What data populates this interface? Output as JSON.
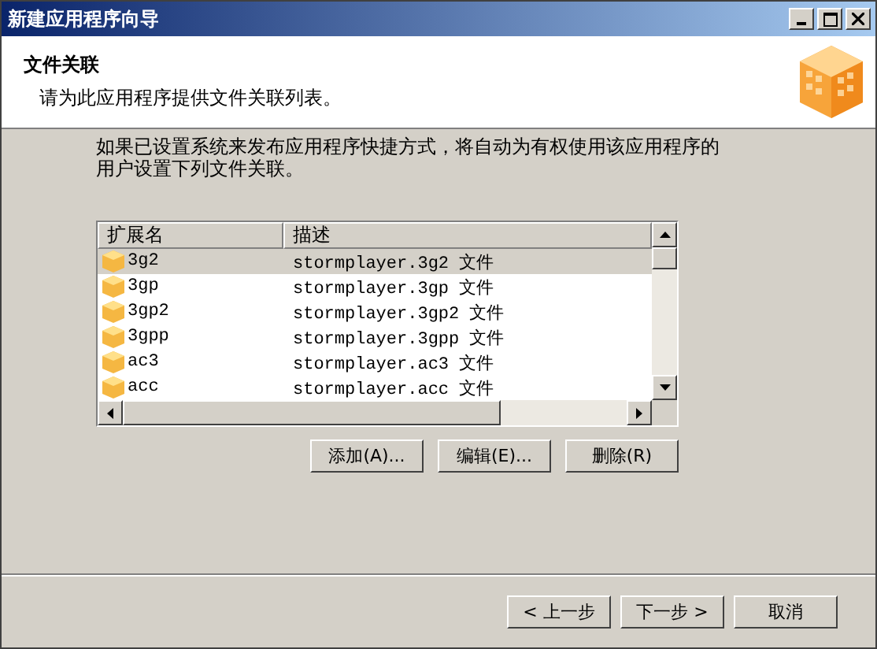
{
  "window": {
    "title": "新建应用程序向导"
  },
  "header": {
    "title": "文件关联",
    "subtitle": "请为此应用程序提供文件关联列表。"
  },
  "description": "如果已设置系统来发布应用程序快捷方式，将自动为有权使用该应用程序的用户设置下列文件关联。",
  "table": {
    "columns": [
      "扩展名",
      "描述"
    ],
    "rows": [
      {
        "extension": "3g2",
        "description": "stormplayer.3g2 文件",
        "selected": true
      },
      {
        "extension": "3gp",
        "description": "stormplayer.3gp 文件",
        "selected": false
      },
      {
        "extension": "3gp2",
        "description": "stormplayer.3gp2 文件",
        "selected": false
      },
      {
        "extension": "3gpp",
        "description": "stormplayer.3gpp 文件",
        "selected": false
      },
      {
        "extension": "ac3",
        "description": "stormplayer.ac3 文件",
        "selected": false
      },
      {
        "extension": "acc",
        "description": "stormplayer.acc 文件",
        "selected": false
      }
    ]
  },
  "list_buttons": [
    "添加(A)...",
    "编辑(E)...",
    "删除(R)"
  ],
  "nav_buttons": [
    "< 上一步",
    "下一步 >",
    "取消"
  ]
}
